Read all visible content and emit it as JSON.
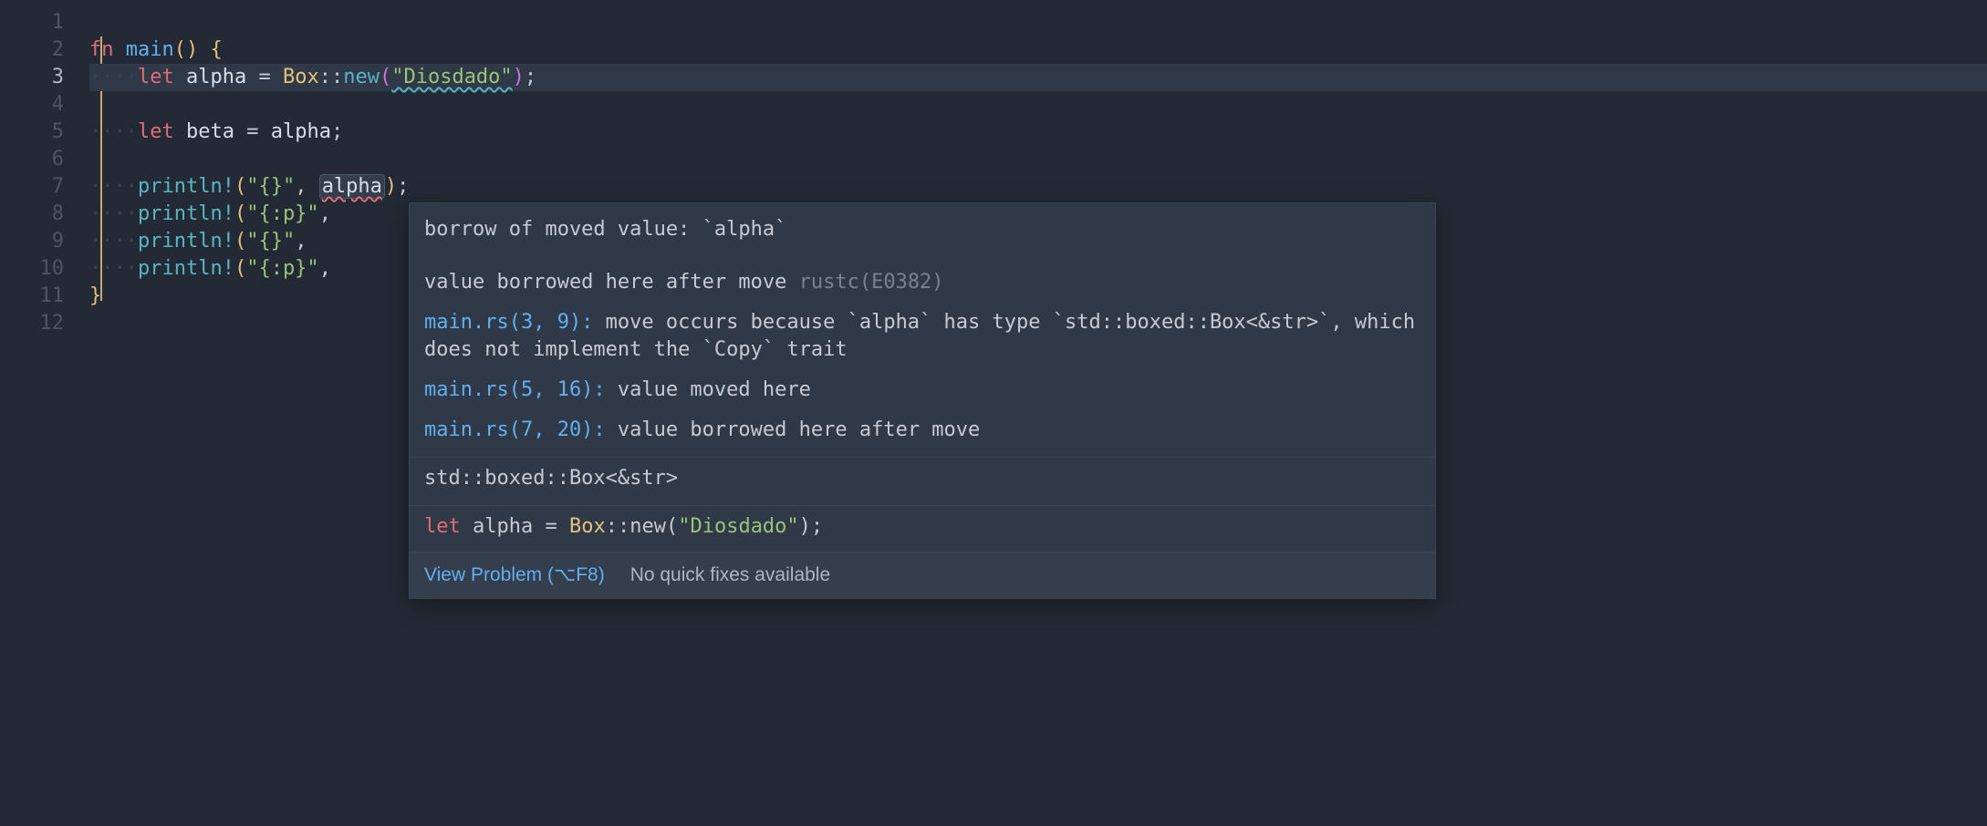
{
  "gutter": {
    "lines": [
      "1",
      "2",
      "3",
      "4",
      "5",
      "6",
      "7",
      "8",
      "9",
      "10",
      "11",
      "12"
    ],
    "current": 3
  },
  "code": {
    "dots": "····",
    "kw_fn": "fn",
    "fn_main": "main",
    "brace_open": "{",
    "brace_close": "}",
    "kw_let": "let",
    "var_alpha": "alpha",
    "var_beta": "beta",
    "box_t": "Box",
    "box_new": "new",
    "str_lit": "\"Diosdado\"",
    "println": "println!",
    "fmt_plain": "\"{}\"",
    "fmt_ptr": "\"{:p}\"",
    "semi": ";",
    "eq": " = ",
    "cc": "::",
    "comma": ", "
  },
  "hover": {
    "title": "borrow of moved value: `alpha`",
    "msg_pre": "value borrowed here after move ",
    "msg_code": "rustc(E0382)",
    "note1_loc": "main.rs(3, 9):",
    "note1_txt": " move occurs because `alpha` has type `std::boxed::Box<&str>`, which does not implement the `Copy` trait",
    "note2_loc": "main.rs(5, 16):",
    "note2_txt": " value moved here",
    "note3_loc": "main.rs(7, 20):",
    "note3_txt": " value borrowed here after move",
    "type_sig": "std::boxed::Box<&str>",
    "sig_let": "let",
    "sig_var": " alpha ",
    "sig_eq": "= ",
    "sig_box": "Box",
    "sig_cc": "::",
    "sig_new": "new",
    "sig_po": "(",
    "sig_str": "\"Diosdado\"",
    "sig_pc": ")",
    "sig_semi": ";",
    "footer_view": "View Problem (⌥F8)",
    "footer_quick": "No quick fixes available"
  }
}
